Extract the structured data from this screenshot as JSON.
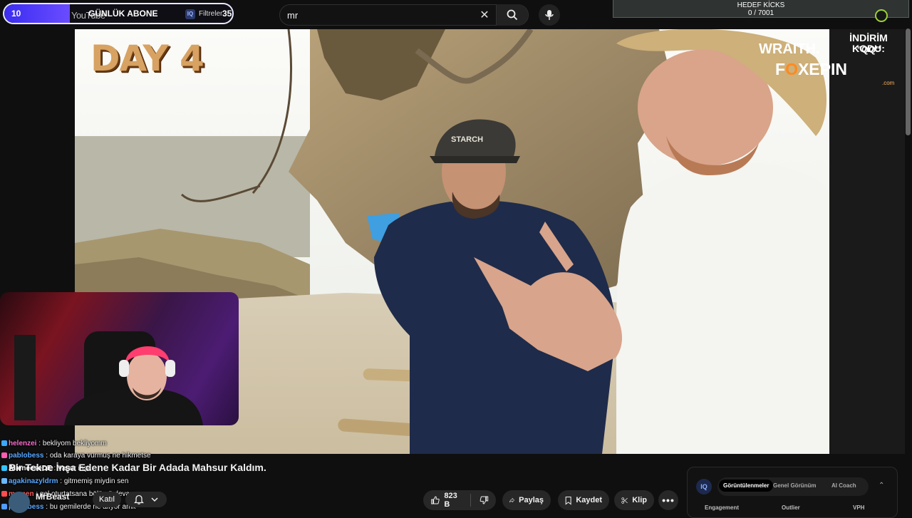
{
  "search": {
    "query": "mr"
  },
  "overlay": {
    "sub_goal": {
      "current": "10",
      "brand": "YouTube",
      "title": "GÜNLÜK ABONE",
      "iq_badge": "IQ",
      "filter_label": "Filtreler",
      "target": "35"
    },
    "kicks_goal": {
      "title": "HEDEF KİCKS",
      "progress": "0 / 7001",
      "progress_fraction": 0.0
    }
  },
  "video": {
    "day_label": "DAY 4",
    "cap_logo_text": "STARCH",
    "title": "Bir Tekne İnşa Edene Kadar Bir Adada Mahsur Kaldım."
  },
  "sponsor": {
    "discount_label": "İNDİRİM KODU:",
    "discount_code": "\"QQ\"",
    "wraith": "WRAITH.",
    "fox_prefix": "F",
    "fox_o": "O",
    "fox_suffix": "XEPIN",
    "fox_domain": ".com"
  },
  "chat": [
    {
      "user": "helenzei",
      "message": "bekliyom bekliyomm",
      "color": "#ff6bcd"
    },
    {
      "user": "pablobess",
      "message": "oda karaya vurmuş ne hikmetse",
      "color": "#59a8ff"
    },
    {
      "user": "AlieneeseDE",
      "message": "Vapur inşa",
      "color": "#ffffff"
    },
    {
      "user": "agakinazyldrm",
      "message": "gitmemiş miydin sen",
      "color": "#59a8ff"
    },
    {
      "user": "momen",
      "message": "gel oturtatsana bölümü devam",
      "color": "#ff5b5b"
    },
    {
      "user": "pablobess",
      "message": "bu gemilerde ne alıyor amk",
      "color": "#59a8ff"
    }
  ],
  "channel": {
    "name": "MrBeast",
    "join_label": "Katıl"
  },
  "actions": {
    "likes": "823 B",
    "share": "Paylaş",
    "save": "Kaydet",
    "clip": "Klip"
  },
  "analytics": {
    "badge": "IQ",
    "tabs": [
      "Görüntülenmeler",
      "Genel Görünüm",
      "AI Coach"
    ],
    "active_tab": 0,
    "metrics": [
      "Engagement",
      "Outlier",
      "VPH"
    ]
  }
}
